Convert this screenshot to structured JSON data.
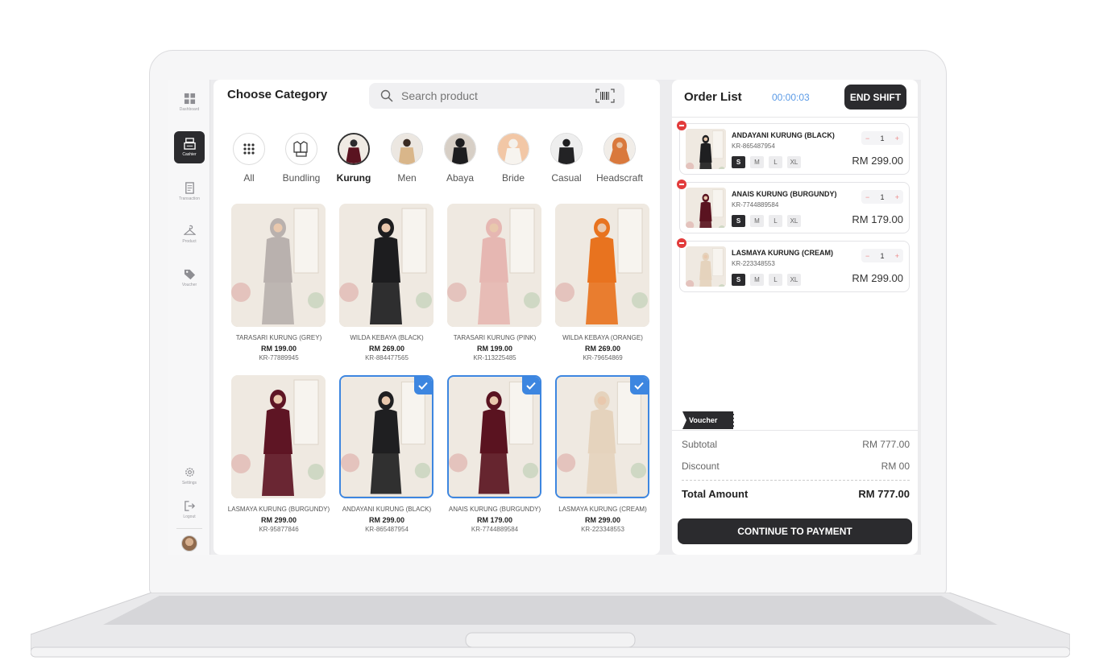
{
  "sidebar": {
    "items": [
      {
        "label": "Dashboard",
        "icon": "grid-icon"
      },
      {
        "label": "Cashier",
        "icon": "register-icon"
      },
      {
        "label": "Transaction",
        "icon": "receipt-icon"
      },
      {
        "label": "Product",
        "icon": "hanger-icon"
      },
      {
        "label": "Voucher",
        "icon": "tag-icon"
      },
      {
        "label": "Settings",
        "icon": "gear-icon"
      },
      {
        "label": "Logout",
        "icon": "logout-icon"
      }
    ]
  },
  "main": {
    "title": "Choose Category",
    "search_placeholder": "Search product",
    "categories": [
      "All",
      "Bundling",
      "Kurung",
      "Men",
      "Abaya",
      "Bride",
      "Casual",
      "Headscraft"
    ],
    "active_category": "Kurung",
    "products": [
      {
        "name": "TARASARI KURUNG (GREY)",
        "price": "RM 199.00",
        "sku": "KR-77889945",
        "color": "#b9b1ae",
        "selected": false
      },
      {
        "name": "WILDA KEBAYA (BLACK)",
        "price": "RM 269.00",
        "sku": "KR-884477565",
        "color": "#1d1d1f",
        "selected": false
      },
      {
        "name": "TARASARI KURUNG (PINK)",
        "price": "RM 199.00",
        "sku": "KR-113225485",
        "color": "#e6b7b2",
        "selected": false
      },
      {
        "name": "WILDA KEBAYA (ORANGE)",
        "price": "RM 269.00",
        "sku": "KR-79654869",
        "color": "#e8731f",
        "selected": false
      },
      {
        "name": "LASMAYA KURUNG (BURGUNDY)",
        "price": "RM 299.00",
        "sku": "KR-95877846",
        "color": "#5e1524",
        "selected": false
      },
      {
        "name": "ANDAYANI KURUNG (BLACK)",
        "price": "RM 299.00",
        "sku": "KR-865487954",
        "color": "#1f1f21",
        "selected": true
      },
      {
        "name": "ANAIS KURUNG (BURGUNDY)",
        "price": "RM 179.00",
        "sku": "KR-7744889584",
        "color": "#5a1320",
        "selected": true
      },
      {
        "name": "LASMAYA KURUNG (CREAM)",
        "price": "RM 299.00",
        "sku": "KR-223348553",
        "color": "#e5d3bd",
        "selected": true
      }
    ]
  },
  "order": {
    "title": "Order List",
    "timer": "00:00:03",
    "end_shift": "END SHIFT",
    "items": [
      {
        "name": "ANDAYANI KURUNG (BLACK)",
        "sku": "KR-865487954",
        "qty": "1",
        "price": "RM 299.00",
        "color": "#1f1f21"
      },
      {
        "name": "ANAIS KURUNG (BURGUNDY)",
        "sku": "KR-7744889584",
        "qty": "1",
        "price": "RM 179.00",
        "color": "#5a1320"
      },
      {
        "name": "LASMAYA KURUNG (CREAM)",
        "sku": "KR-223348553",
        "qty": "1",
        "price": "RM 299.00",
        "color": "#e5d3bd"
      }
    ],
    "sizes": [
      "S",
      "M",
      "L",
      "XL"
    ],
    "selected_size": "S",
    "minus": "−",
    "plus": "+",
    "voucher_label": "Voucher",
    "subtotal_label": "Subtotal",
    "subtotal_value": "RM 777.00",
    "discount_label": "Discount",
    "discount_value": "RM 00",
    "total_label": "Total Amount",
    "total_value": "RM 777.00",
    "pay_button": "CONTINUE TO PAYMENT"
  }
}
